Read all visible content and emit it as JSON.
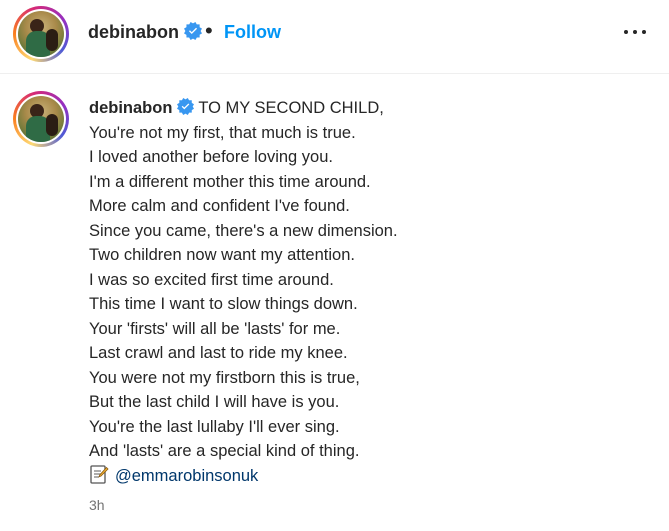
{
  "header": {
    "username": "debinabon",
    "separator": "•",
    "follow_label": "Follow",
    "more_icon": "more-horizontal-icon"
  },
  "caption": {
    "username": "debinabon",
    "first_line": "TO MY SECOND CHILD,",
    "lines": [
      "You're not my first, that much is true.",
      "I loved another before loving you.",
      "I'm a different mother this time around.",
      "More calm and confident I've found.",
      "Since you came, there's a new dimension.",
      "Two children now want my attention.",
      "I was so excited first time around.",
      "This time I want to slow things down.",
      "Your 'firsts' will all be 'lasts' for me.",
      "Last crawl and last to ride my knee.",
      "You were not my firstborn this is true,",
      "But the last child I will have is you.",
      "You're the last lullaby I'll ever sing.",
      "And 'lasts' are a special kind of thing."
    ],
    "credit_icon": "memo-icon",
    "mention": "@emmarobinsonuk",
    "timestamp": "3h"
  },
  "colors": {
    "follow": "#0095f6",
    "verified": "#3897f0",
    "mention": "#00376b",
    "timestamp": "#737373"
  }
}
